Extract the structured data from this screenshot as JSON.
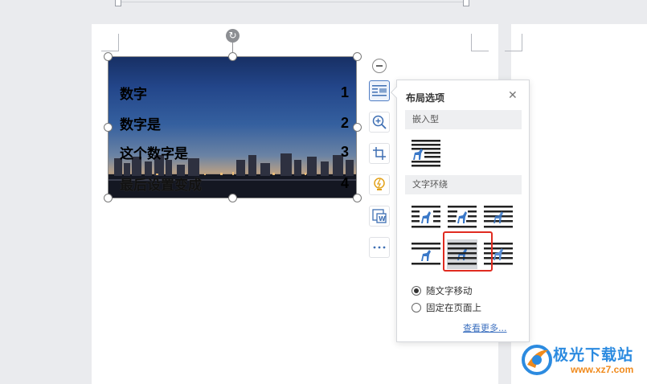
{
  "image": {
    "rows": [
      {
        "text": "数字",
        "num": "1"
      },
      {
        "text": "数字是",
        "num": "2"
      },
      {
        "text": "这个数字是",
        "num": "3"
      },
      {
        "text": "最后设置变成",
        "num": "4"
      }
    ]
  },
  "side_toolbar": {
    "buttons": [
      {
        "name": "layout-options-icon"
      },
      {
        "name": "zoom-in-icon"
      },
      {
        "name": "crop-icon"
      },
      {
        "name": "smart-bulb-icon"
      },
      {
        "name": "image-to-text-icon"
      },
      {
        "name": "more-ellipsis-icon"
      }
    ]
  },
  "layout_popup": {
    "title": "布局选项",
    "inline_section": "嵌入型",
    "wrap_section": "文字环绕",
    "wrap_options": [
      "square-wrap",
      "tight-wrap",
      "through-wrap",
      "top-bottom-wrap",
      "behind-text",
      "in-front-of-text"
    ],
    "selected_option": "behind-text",
    "move_with_text": "随文字移动",
    "fix_on_page": "固定在页面上",
    "selected_position": "move_with_text",
    "more_link": "查看更多..."
  },
  "watermark": {
    "title": "极光下载站",
    "url": "www.xz7.com"
  },
  "colors": {
    "accent": "#3b6fbf",
    "highlight": "#e02b20"
  }
}
